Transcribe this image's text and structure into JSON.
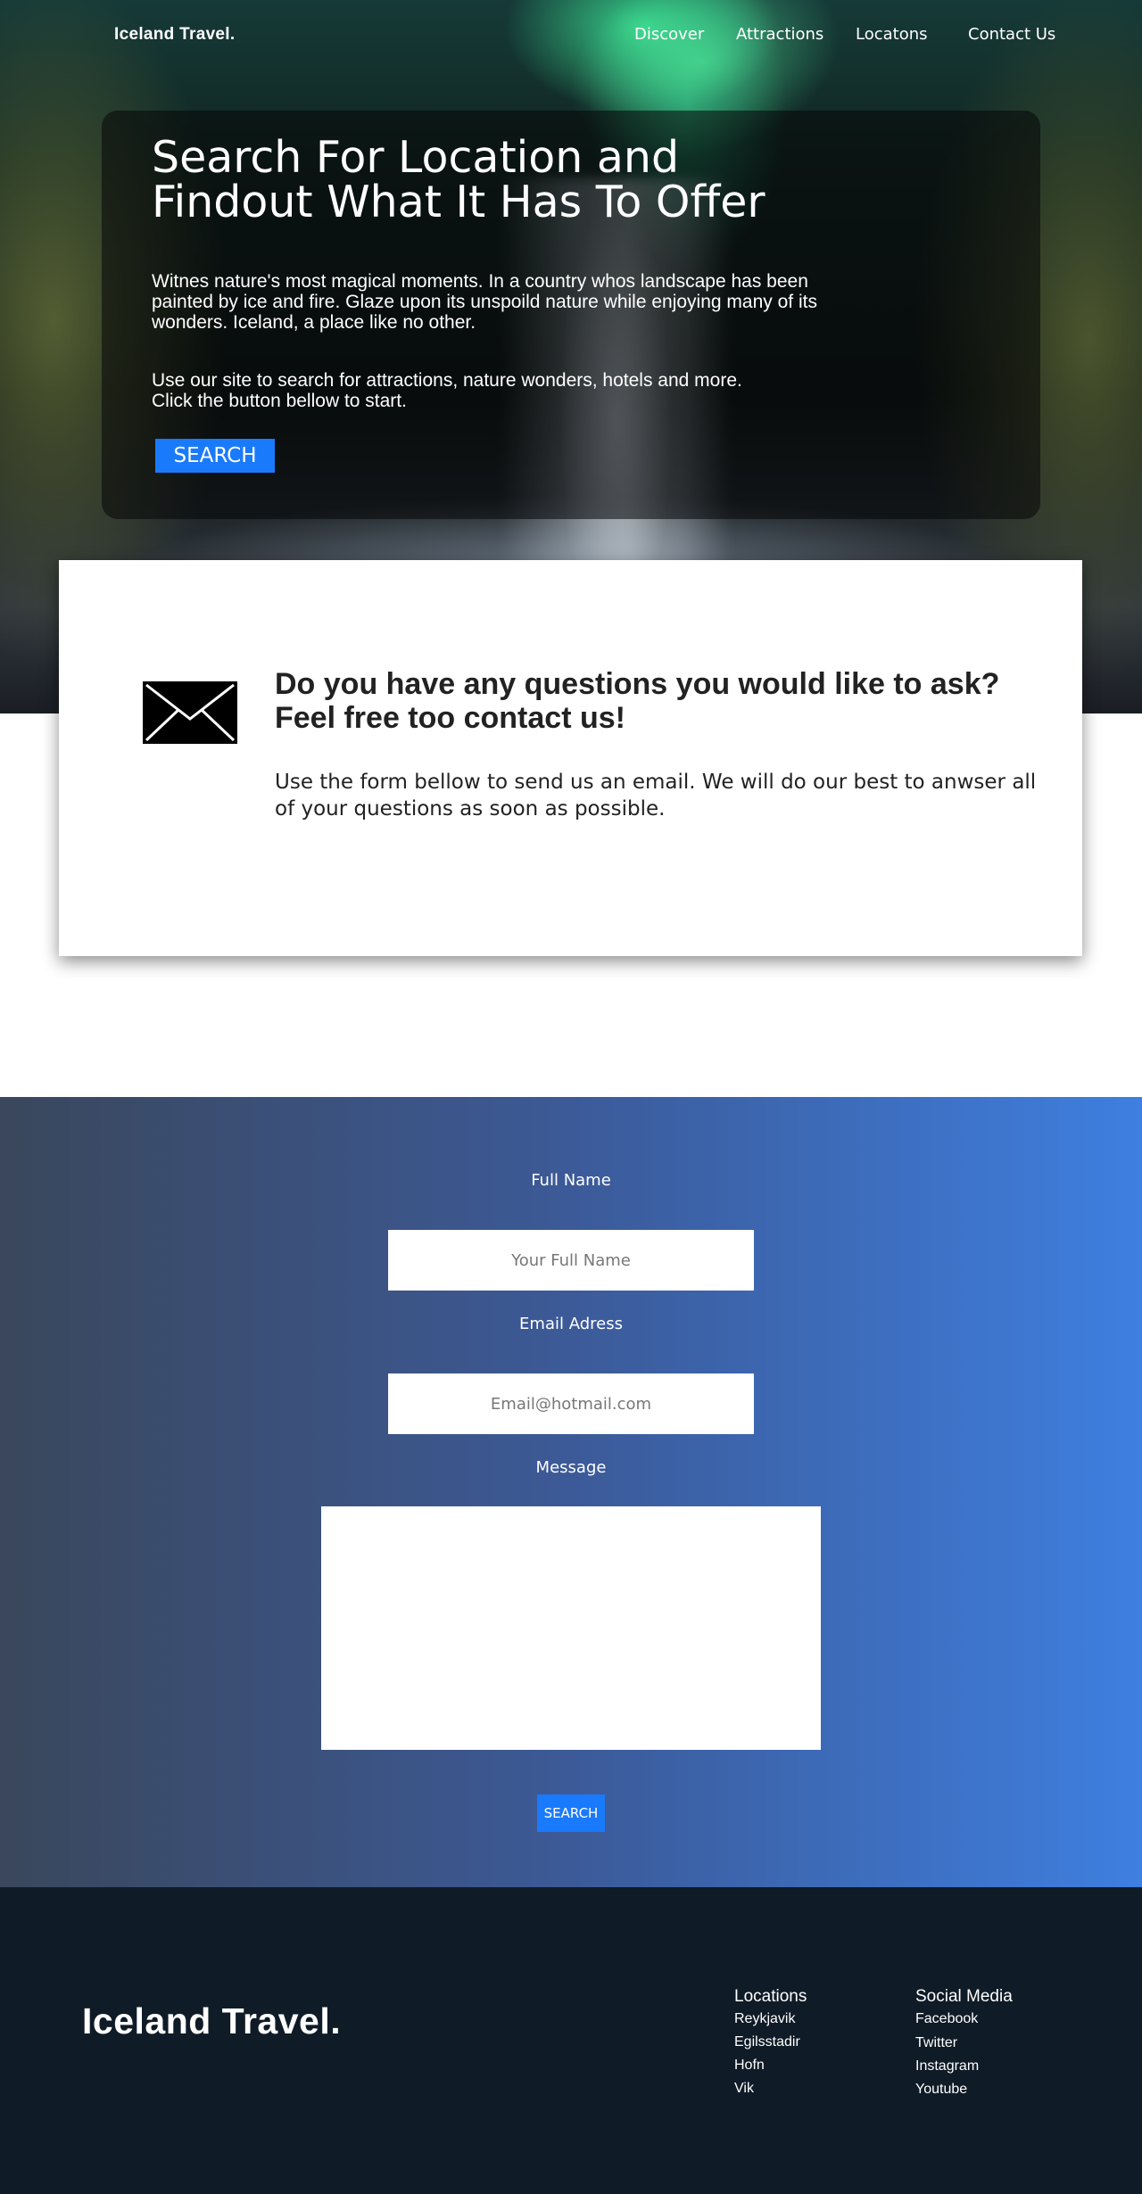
{
  "nav": {
    "brand": "Iceland Travel.",
    "links": [
      "Discover",
      "Attractions",
      "Locatons",
      "Contact Us"
    ]
  },
  "hero": {
    "title": "Search For Location and Findout What It Has To Offer",
    "paragraph1": "Witnes nature's most magical moments. In a country whos landscape has been painted by ice and fire. Glaze upon its unspoild nature while enjoying many of its wonders. Iceland, a place like no other.",
    "paragraph2_line1": "Use our site to search for attractions, nature wonders, hotels and more.",
    "paragraph2_line2": "Click the button bellow to start.",
    "search_button": "SEARCH"
  },
  "contact": {
    "icon": "envelope-icon",
    "title": "Do you have any questions you would like to ask? Feel free too contact us!",
    "description": "Use the form bellow to send us an email. We will do our best to anwser all of your questions as soon as possible."
  },
  "form": {
    "full_name_label": "Full Name",
    "full_name_placeholder": "Your Full Name",
    "full_name_value": "",
    "email_label": "Email Adress",
    "email_placeholder": "Email@hotmail.com",
    "email_value": "",
    "message_label": "Message",
    "message_value": "",
    "submit_button": "SEARCH"
  },
  "footer": {
    "brand": "Iceland Travel.",
    "locations_heading": "Locations",
    "locations": [
      "Reykjavik",
      "Egilsstadir",
      "Hofn",
      "Vik"
    ],
    "social_heading": "Social Media",
    "social": [
      "Facebook",
      "Twitter",
      "Instagram",
      "Youtube"
    ]
  },
  "colors": {
    "accent_blue": "#1a7afc",
    "footer_bg": "#0f1b26",
    "gradient_start": "#3a475c",
    "gradient_end": "#3e7fe0"
  }
}
